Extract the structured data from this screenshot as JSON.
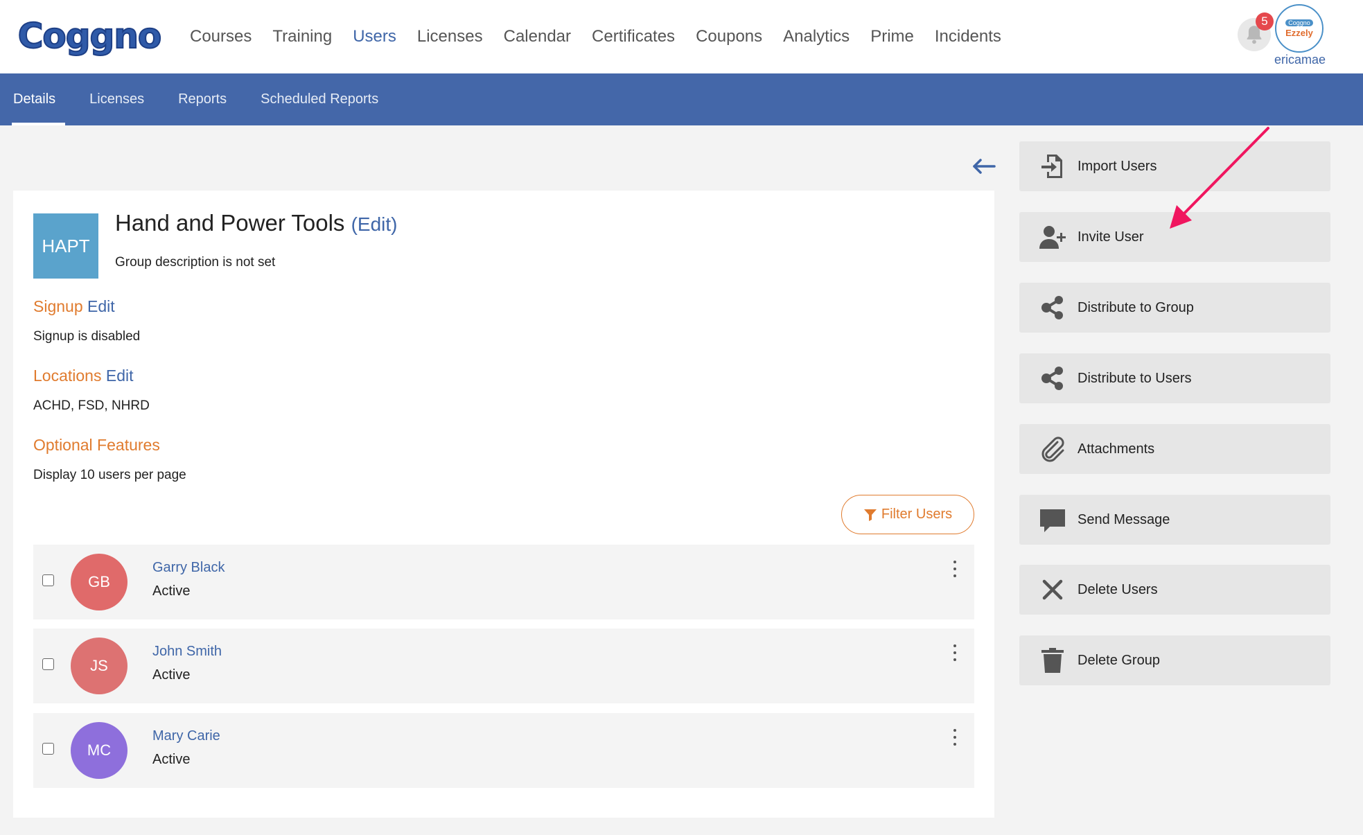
{
  "app": {
    "logo_text": "Coggno",
    "nav": [
      "Courses",
      "Training",
      "Users",
      "Licenses",
      "Calendar",
      "Certificates",
      "Coupons",
      "Analytics",
      "Prime",
      "Incidents"
    ],
    "active_nav": "Users",
    "notifications_count": "5",
    "avatar_line1": "Coggno",
    "avatar_line2": "Ezzely",
    "username": "ericamae"
  },
  "subnav": {
    "tabs": [
      "Details",
      "Licenses",
      "Reports",
      "Scheduled Reports"
    ],
    "active": "Details"
  },
  "group": {
    "badge": "HAPT",
    "title": "Hand and Power Tools",
    "title_edit": "(Edit)",
    "description": "Group description is not set",
    "signup_label": "Signup",
    "signup_edit": "Edit",
    "signup_value": "Signup is disabled",
    "locations_label": "Locations",
    "locations_edit": "Edit",
    "locations_value": "ACHD, FSD, NHRD",
    "optional_label": "Optional Features",
    "optional_value": "Display 10 users per page"
  },
  "filter_button": "Filter Users",
  "users": [
    {
      "initials": "GB",
      "name": "Garry Black",
      "status": "Active",
      "color": "#e06a6a"
    },
    {
      "initials": "JS",
      "name": "John Smith",
      "status": "Active",
      "color": "#dd7272"
    },
    {
      "initials": "MC",
      "name": "Mary Carie",
      "status": "Active",
      "color": "#8e6fdc"
    }
  ],
  "actions": {
    "import": "Import Users",
    "invite": "Invite User",
    "distribute_group": "Distribute to Group",
    "distribute_users": "Distribute to Users",
    "attachments": "Attachments",
    "send_message": "Send Message",
    "delete_users": "Delete Users",
    "delete_group": "Delete Group"
  },
  "colors": {
    "brand_blue": "#4467a9",
    "link_blue": "#3f66a8",
    "accent_orange": "#e07b2e",
    "annotation_pink": "#f0165f"
  }
}
